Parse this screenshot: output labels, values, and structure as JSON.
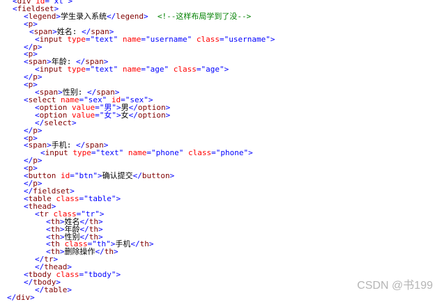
{
  "code_lines": [
    {
      "indent": 1,
      "text": "<div id=\"xt\">"
    },
    {
      "indent": 1,
      "text": "<fieldset>"
    },
    {
      "indent": 3,
      "text": "<legend>学生录入系统</legend>  <!--这样布局学到了没-->"
    },
    {
      "indent": 3,
      "text": "<p>"
    },
    {
      "indent": 4,
      "text": "<span>姓名: </span>"
    },
    {
      "indent": 5,
      "text": "<input type=\"text\" name=\"username\" class=\"username\">"
    },
    {
      "indent": 3,
      "text": "</p>"
    },
    {
      "indent": 3,
      "text": "<p>"
    },
    {
      "indent": 3,
      "text": "<span>年龄: </span>"
    },
    {
      "indent": 5,
      "text": "<input type=\"text\" name=\"age\" class=\"age\">"
    },
    {
      "indent": 3,
      "text": "</p>"
    },
    {
      "indent": 3,
      "text": "<p>"
    },
    {
      "indent": 5,
      "text": "<span>性别: </span>"
    },
    {
      "indent": 3,
      "text": "<select name=\"sex\" id=\"sex\">"
    },
    {
      "indent": 5,
      "text": "<option value=\"男\">男</option>"
    },
    {
      "indent": 5,
      "text": "<option value=\"女\">女</option>"
    },
    {
      "indent": 5,
      "text": "</select>"
    },
    {
      "indent": 3,
      "text": "</p>"
    },
    {
      "indent": 3,
      "text": "<p>"
    },
    {
      "indent": 3,
      "text": "<span>手机: </span>"
    },
    {
      "indent": 6,
      "text": "<input type=\"text\" name=\"phone\" class=\"phone\">"
    },
    {
      "indent": 3,
      "text": "</p>"
    },
    {
      "indent": 3,
      "text": "<p>"
    },
    {
      "indent": 3,
      "text": "<button id=\"btn\">确认提交</button>"
    },
    {
      "indent": 3,
      "text": "</p>"
    },
    {
      "indent": 3,
      "text": "</fieldset>"
    },
    {
      "indent": 3,
      "text": "<table class=\"table\">"
    },
    {
      "indent": 3,
      "text": "<thead>"
    },
    {
      "indent": 5,
      "text": "<tr class=\"tr\">"
    },
    {
      "indent": 7,
      "text": "<th>姓名</th>"
    },
    {
      "indent": 7,
      "text": "<th>年龄</th>"
    },
    {
      "indent": 7,
      "text": "<th>性别</th>"
    },
    {
      "indent": 7,
      "text": "<th class=\"th\">手机</th>"
    },
    {
      "indent": 7,
      "text": "<th>删除操作</th>"
    },
    {
      "indent": 5,
      "text": "</tr>"
    },
    {
      "indent": 5,
      "text": "</thead>"
    },
    {
      "indent": 3,
      "text": "<tbody class=\"tbody\">"
    },
    {
      "indent": 3,
      "text": "</tbody>"
    },
    {
      "indent": 5,
      "text": "</table>"
    },
    {
      "indent": 0,
      "text": "</div>"
    }
  ],
  "watermark": "CSDN @书199"
}
